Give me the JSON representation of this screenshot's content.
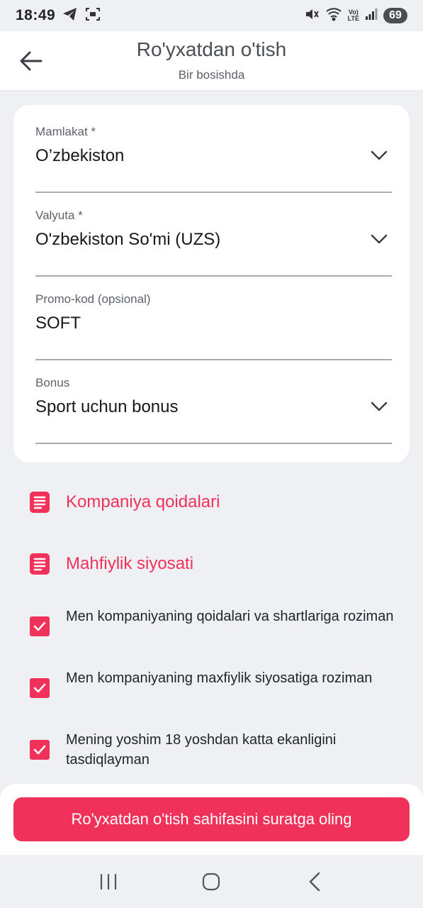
{
  "status_bar": {
    "time": "18:49",
    "battery": "69",
    "network_lte_top": "Vo)",
    "network_lte_bottom": "LTE"
  },
  "header": {
    "title": "Ro'yxatdan o'tish",
    "subtitle": "Bir bosishda"
  },
  "form": {
    "country": {
      "label": "Mamlakat *",
      "value": "O’zbekiston"
    },
    "currency": {
      "label": "Valyuta *",
      "value": "O'zbekiston So'mi (UZS)"
    },
    "promo": {
      "label": "Promo-kod (opsional)",
      "value": "SOFT"
    },
    "bonus": {
      "label": "Bonus",
      "value": "Sport uchun bonus"
    }
  },
  "links": {
    "rules": "Kompaniya qoidalari",
    "privacy": "Mahfiylik siyosati"
  },
  "checkboxes": [
    {
      "label": "Men kompaniyaning qoidalari va shartlariga roziman",
      "checked": true
    },
    {
      "label": "Men kompaniyaning maxfiylik siyosatiga roziman",
      "checked": true
    },
    {
      "label": "Mening yoshim 18 yoshdan katta ekanligini tasdiqlayman",
      "checked": true
    }
  ],
  "action": {
    "button_label": "Ro'yxatdan o'tish sahifasini suratga oling"
  },
  "colors": {
    "accent": "#f0325a",
    "background": "#eef0f3",
    "card": "#ffffff"
  }
}
